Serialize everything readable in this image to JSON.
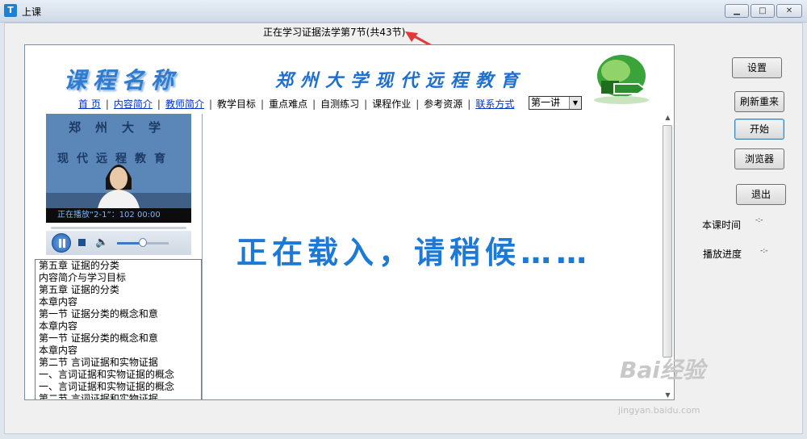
{
  "window": {
    "title": "上课",
    "icon": "app-icon"
  },
  "lesson_status": "正在学习证据法学第7节(共43节)",
  "banner": {
    "course_name": "课程名称",
    "school": "郑州大学现代远程教育"
  },
  "nav": [
    {
      "label": "首 页",
      "link": true
    },
    {
      "label": "内容简介",
      "link": true
    },
    {
      "label": "教师简介",
      "link": true
    },
    {
      "label": "教学目标",
      "link": false
    },
    {
      "label": "重点难点",
      "link": false
    },
    {
      "label": "自测练习",
      "link": false
    },
    {
      "label": "课程作业",
      "link": false
    },
    {
      "label": "参考资源",
      "link": false
    },
    {
      "label": "联系方式",
      "link": true
    }
  ],
  "lecture_select": {
    "value": "第一讲"
  },
  "video": {
    "overlay_line1": "郑州大学",
    "overlay_line2": "现代远程教育",
    "status": "正在播放“2-1”：102    00:00"
  },
  "player": {
    "volume_level": 0.5
  },
  "outline": [
    "第五章  证据的分类",
    "内容简介与学习目标",
    "第五章  证据的分类",
    "本章内容",
    "第一节  证据分类的概念和意",
    "本章内容",
    "第一节  证据分类的概念和意",
    "本章内容",
    "第二节  言词证据和实物证据",
    "一、言词证据和实物证据的概念",
    "一、言词证据和实物证据的概念",
    "第二节  言词证据和实物证据"
  ],
  "loading_text": "正在载入，请稍候……",
  "side": {
    "settings": "设置",
    "refresh": "刷新重来",
    "start": "开始",
    "browser": "浏览器",
    "exit": "退出",
    "class_time_label": "本课时间",
    "class_time_value": "-:-",
    "progress_label": "播放进度",
    "progress_value": "-:-"
  },
  "watermark": {
    "main": "Bai经验",
    "sub": "jingyan.baidu.com"
  },
  "colors": {
    "loading_text": "#1c79d6",
    "link": "#0033cc",
    "annotation_arrow": "#e23a3a"
  }
}
